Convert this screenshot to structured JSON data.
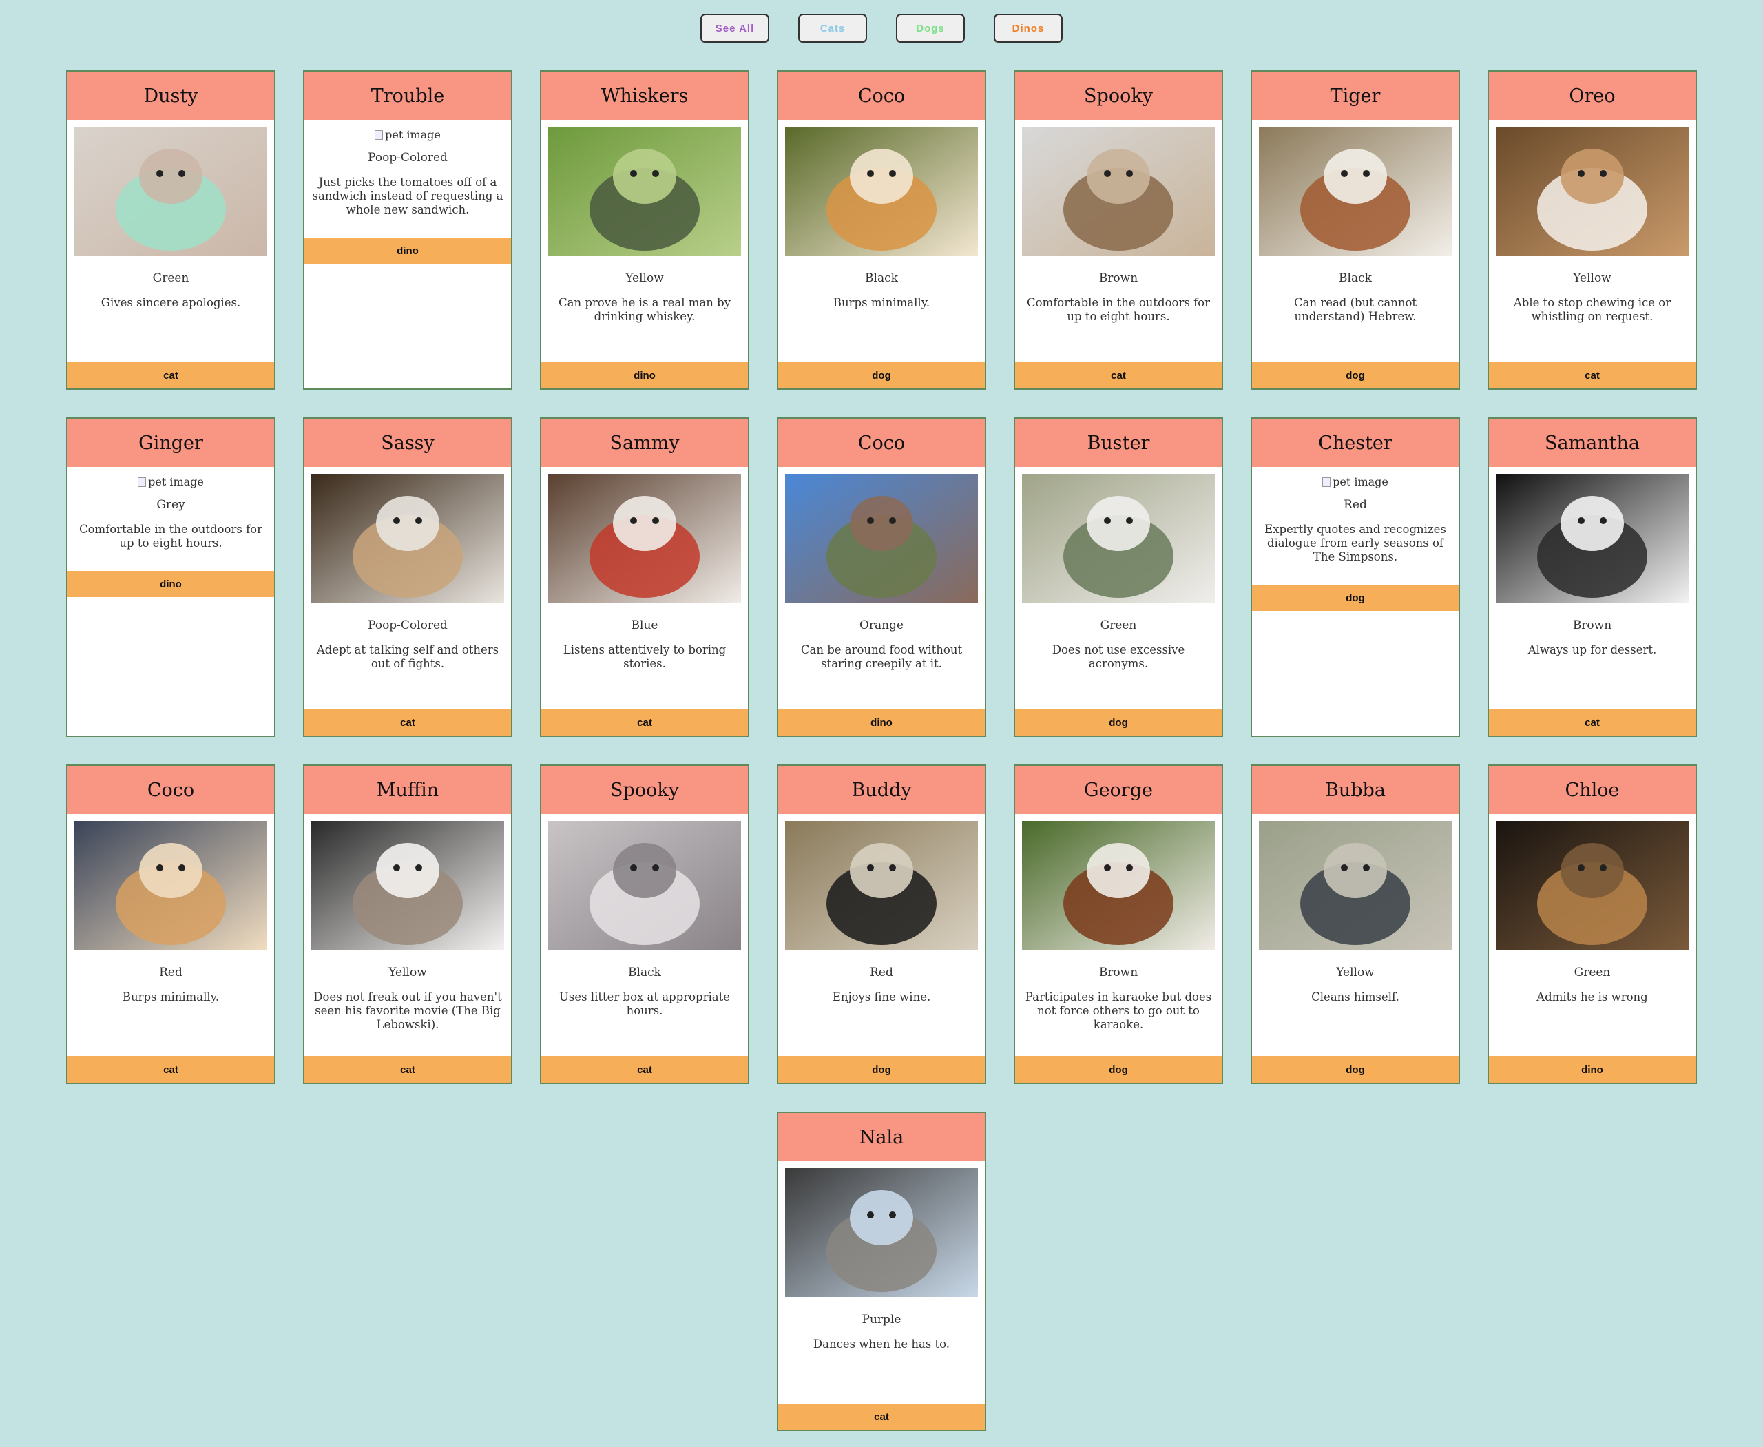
{
  "filters": [
    {
      "label": "See All",
      "color": "#a45fc6"
    },
    {
      "label": "Cats",
      "color": "#8ec9e8"
    },
    {
      "label": "Dogs",
      "color": "#7fe08a"
    },
    {
      "label": "Dinos",
      "color": "#f07f28"
    }
  ],
  "broken_image_alt": "pet image",
  "pets": [
    {
      "name": "Dusty",
      "color": "Green",
      "trait": "Gives sincere apologies.",
      "type": "cat",
      "image": true,
      "palette": [
        "#d9d3cc",
        "#9fe0c8",
        "#cbb7a8"
      ]
    },
    {
      "name": "Trouble",
      "color": "Poop-Colored",
      "trait": "Just picks the tomatoes off of a sandwich instead of requesting a whole new sandwich.",
      "type": "dino",
      "image": false
    },
    {
      "name": "Whiskers",
      "color": "Yellow",
      "trait": "Can prove he is a real man by drinking whiskey.",
      "type": "dino",
      "image": true,
      "palette": [
        "#6e9a3c",
        "#4a5a3e",
        "#b8cf8a"
      ]
    },
    {
      "name": "Coco",
      "color": "Black",
      "trait": "Burps minimally.",
      "type": "dog",
      "image": true,
      "palette": [
        "#5a6a2a",
        "#d99444",
        "#f2e6d0"
      ]
    },
    {
      "name": "Spooky",
      "color": "Brown",
      "trait": "Comfortable in the outdoors for up to eight hours.",
      "type": "cat",
      "image": true,
      "palette": [
        "#d8d8d8",
        "#8a6a4a",
        "#c9b49a"
      ]
    },
    {
      "name": "Tiger",
      "color": "Black",
      "trait": "Can read (but cannot understand) Hebrew.",
      "type": "dog",
      "image": true,
      "palette": [
        "#8c7a5a",
        "#a15a30",
        "#f2eee8"
      ]
    },
    {
      "name": "Oreo",
      "color": "Yellow",
      "trait": "Able to stop chewing ice or whistling on request.",
      "type": "cat",
      "image": true,
      "palette": [
        "#6a4a2a",
        "#f4f0ea",
        "#c99a6a"
      ]
    },
    {
      "name": "Ginger",
      "color": "Grey",
      "trait": "Comfortable in the outdoors for up to eight hours.",
      "type": "dino",
      "image": false
    },
    {
      "name": "Sassy",
      "color": "Poop-Colored",
      "trait": "Adept at talking self and others out of fights.",
      "type": "cat",
      "image": true,
      "palette": [
        "#3a2a1a",
        "#c9a47a",
        "#e8e4de"
      ]
    },
    {
      "name": "Sammy",
      "color": "Blue",
      "trait": "Listens attentively to boring stories.",
      "type": "cat",
      "image": true,
      "palette": [
        "#5a4030",
        "#c23a2a",
        "#f0ebe6"
      ]
    },
    {
      "name": "Coco",
      "color": "Orange",
      "trait": "Can be around food without staring creepily at it.",
      "type": "dino",
      "image": true,
      "palette": [
        "#4a88d8",
        "#6a7a4a",
        "#8a6a5a"
      ]
    },
    {
      "name": "Buster",
      "color": "Green",
      "trait": "Does not use excessive acronyms.",
      "type": "dog",
      "image": true,
      "palette": [
        "#a0a488",
        "#6a7a5a",
        "#f0eeec"
      ]
    },
    {
      "name": "Chester",
      "color": "Red",
      "trait": "Expertly quotes and recognizes dialogue from early seasons of The Simpsons.",
      "type": "dog",
      "image": false
    },
    {
      "name": "Samantha",
      "color": "Brown",
      "trait": "Always up for dessert.",
      "type": "cat",
      "image": true,
      "palette": [
        "#101010",
        "#2a2a2a",
        "#f2f2f2"
      ]
    },
    {
      "name": "Coco",
      "color": "Red",
      "trait": "Burps minimally.",
      "type": "cat",
      "image": true,
      "palette": [
        "#3a4458",
        "#d8a060",
        "#f0dcc0"
      ]
    },
    {
      "name": "Muffin",
      "color": "Yellow",
      "trait": "Does not freak out if you haven't seen his favorite movie (The Big Lebowski).",
      "type": "cat",
      "image": true,
      "palette": [
        "#2a2a2a",
        "#9a8a7a",
        "#f4f2f0"
      ]
    },
    {
      "name": "Spooky",
      "color": "Black",
      "trait": "Uses litter box at appropriate hours.",
      "type": "cat",
      "image": true,
      "palette": [
        "#c8c4c6",
        "#e6e2e4",
        "#8a8488"
      ]
    },
    {
      "name": "Buddy",
      "color": "Red",
      "trait": "Enjoys fine wine.",
      "type": "dog",
      "image": true,
      "palette": [
        "#8a7a5a",
        "#1a1a1a",
        "#d8d0c0"
      ]
    },
    {
      "name": "George",
      "color": "Brown",
      "trait": "Participates in karaoke but does not force others to go out to karaoke.",
      "type": "dog",
      "image": true,
      "palette": [
        "#4a6a2a",
        "#7a3a1a",
        "#f0ece6"
      ]
    },
    {
      "name": "Bubba",
      "color": "Yellow",
      "trait": "Cleans himself.",
      "type": "dog",
      "image": true,
      "palette": [
        "#9aa08a",
        "#3a4048",
        "#c8c4b8"
      ]
    },
    {
      "name": "Chloe",
      "color": "Green",
      "trait": "Admits he is wrong",
      "type": "dino",
      "image": true,
      "palette": [
        "#1a1410",
        "#b8844a",
        "#7a5a3a"
      ]
    },
    {
      "name": "Nala",
      "color": "Purple",
      "trait": "Dances when he has to.",
      "type": "cat",
      "image": true,
      "palette": [
        "#3a3a3a",
        "#8a8680",
        "#c8d8e8"
      ]
    }
  ]
}
